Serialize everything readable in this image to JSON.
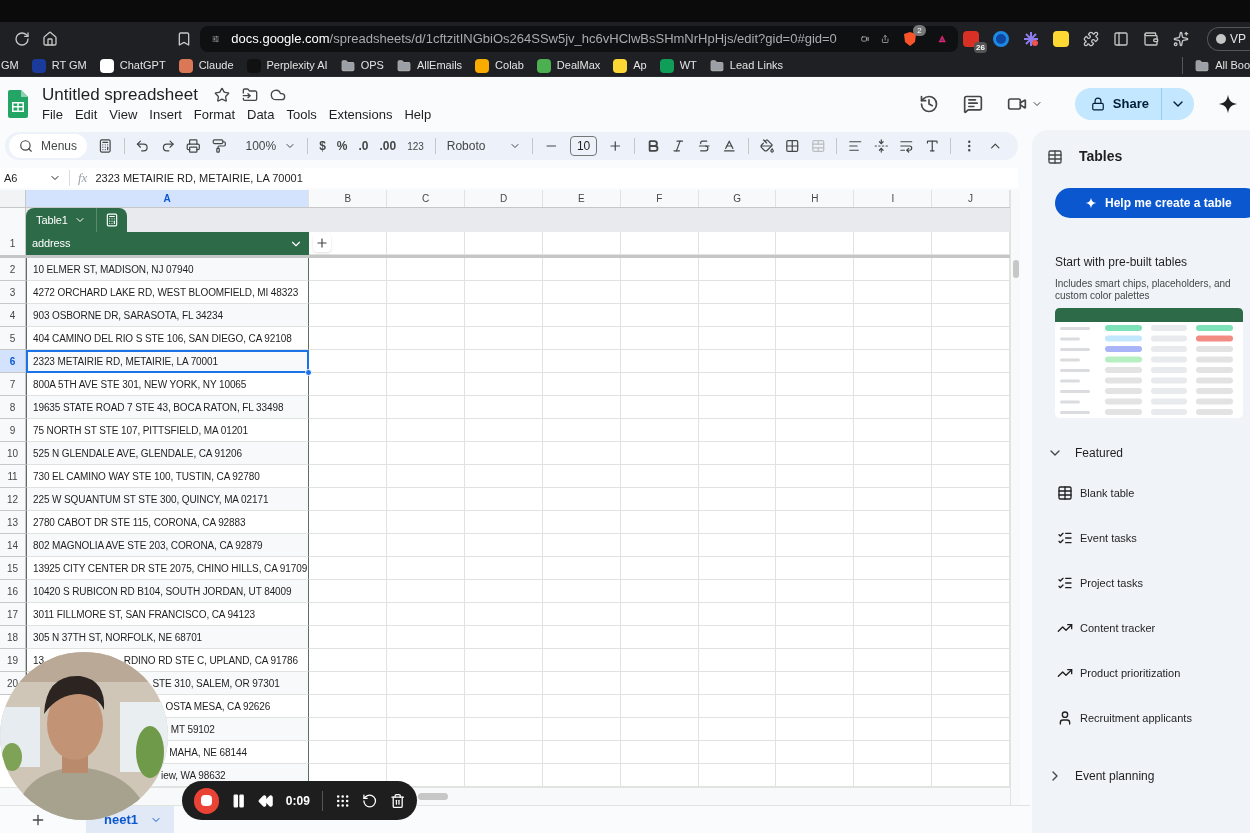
{
  "browser": {
    "url_host": "docs.google.com",
    "url_path": "/spreadsheets/d/1cftzitINGbiOs264SSw5jv_hc6vHClwBsSHmNrHpHjs/edit?gid=0#gid=0",
    "shield_badge": "2",
    "extensions": [
      {
        "kind": "calendar",
        "badge": "26"
      },
      {
        "kind": "ring"
      },
      {
        "kind": "burst"
      },
      {
        "kind": "tile"
      },
      {
        "kind": "puzzle"
      },
      {
        "kind": "sidebar"
      },
      {
        "kind": "wallet"
      },
      {
        "kind": "sparkle"
      }
    ],
    "profile": "VP"
  },
  "bookmarks": [
    {
      "label": "GM"
    },
    {
      "label": "RT GM",
      "kind": "site",
      "color": "#1a3a9c"
    },
    {
      "label": "ChatGPT",
      "kind": "site",
      "color": "#ffffff"
    },
    {
      "label": "Claude",
      "kind": "site",
      "color": "#d97757"
    },
    {
      "label": "Perplexity AI",
      "kind": "site",
      "color": "#111111"
    },
    {
      "label": "OPS",
      "kind": "folder"
    },
    {
      "label": "AllEmails",
      "kind": "folder"
    },
    {
      "label": "Colab",
      "kind": "site",
      "color": "#f9ab00"
    },
    {
      "label": "DealMax",
      "kind": "site",
      "color": "#4caf50"
    },
    {
      "label": "Ap",
      "kind": "site",
      "color": "#fdd835"
    },
    {
      "label": "WT",
      "kind": "site",
      "color": "#0f9d58"
    },
    {
      "label": "Lead Links",
      "kind": "folder"
    }
  ],
  "bookmarks_right": [
    {
      "label": "All Boo",
      "kind": "folder"
    }
  ],
  "document": {
    "title": "Untitled spreadsheet",
    "menus": [
      "File",
      "Edit",
      "View",
      "Insert",
      "Format",
      "Data",
      "Tools",
      "Extensions",
      "Help"
    ],
    "share_label": "Share"
  },
  "toolbar": {
    "search_label": "Menus",
    "zoom": "100%",
    "number_formats": [
      "$",
      "%",
      ".0",
      ".00",
      "123"
    ],
    "font": "Roboto",
    "font_size": "10"
  },
  "formula_bar": {
    "cell_ref": "A6",
    "function_label": "fx",
    "value": "2323 METAIRIE RD, METAIRIE, LA 70001"
  },
  "grid": {
    "columns": [
      {
        "label": "A",
        "selected": true
      },
      {
        "label": "B",
        "selected": false
      },
      {
        "label": "C",
        "selected": false
      },
      {
        "label": "D",
        "selected": false
      },
      {
        "label": "E",
        "selected": false
      },
      {
        "label": "F",
        "selected": false
      },
      {
        "label": "G",
        "selected": false
      },
      {
        "label": "H",
        "selected": false
      },
      {
        "label": "I",
        "selected": false
      },
      {
        "label": "J",
        "selected": false
      }
    ],
    "table_name": "Table1",
    "header_row_number": "1",
    "header": "address",
    "rows": [
      {
        "number": "2",
        "address": "10 ELMER ST, MADISON, NJ 07940",
        "selected": false
      },
      {
        "number": "3",
        "address": "4272 ORCHARD LAKE RD, WEST BLOOMFIELD, MI 48323",
        "selected": false
      },
      {
        "number": "4",
        "address": "903 OSBORNE DR, SARASOTA, FL 34234",
        "selected": false
      },
      {
        "number": "5",
        "address": "404 CAMINO DEL RIO S STE 106, SAN DIEGO, CA 92108",
        "selected": false
      },
      {
        "number": "6",
        "address": "2323 METAIRIE RD, METAIRIE, LA 70001",
        "selected": true
      },
      {
        "number": "7",
        "address": "800A 5TH AVE STE 301, NEW YORK, NY 10065",
        "selected": false
      },
      {
        "number": "8",
        "address": "19635 STATE ROAD 7 STE 43, BOCA RATON, FL 33498",
        "selected": false
      },
      {
        "number": "9",
        "address": "75 NORTH ST STE 107, PITTSFIELD, MA 01201",
        "selected": false
      },
      {
        "number": "10",
        "address": "525 N GLENDALE AVE, GLENDALE, CA 91206",
        "selected": false
      },
      {
        "number": "11",
        "address": "730 EL CAMINO WAY STE 100, TUSTIN, CA 92780",
        "selected": false
      },
      {
        "number": "12",
        "address": "225 W SQUANTUM ST STE 300, QUINCY, MA 02171",
        "selected": false
      },
      {
        "number": "13",
        "address": "2780 CABOT DR STE 115, CORONA, CA 92883",
        "selected": false
      },
      {
        "number": "14",
        "address": "802 MAGNOLIA AVE STE 203, CORONA, CA 92879",
        "selected": false
      },
      {
        "number": "15",
        "address": "13925 CITY CENTER DR STE 2075, CHINO HILLS, CA 91709",
        "selected": false
      },
      {
        "number": "16",
        "address": "10420 S RUBICON RD B104, SOUTH JORDAN, UT 84009",
        "selected": false
      },
      {
        "number": "17",
        "address": "3011 FILLMORE ST, SAN FRANCISCO, CA 94123",
        "selected": false
      },
      {
        "number": "18",
        "address": "305 N 37TH ST, NORFOLK, NE 68701",
        "selected": false
      },
      {
        "number": "19",
        "lead": "13",
        "address": "RDINO RD STE C, UPLAND, CA 91786",
        "selected": false
      },
      {
        "number": "20",
        "address": "STE 310, SALEM, OR 97301",
        "selected": false
      },
      {
        "address": "OSTA MESA, CA 92626",
        "selected": false
      },
      {
        "address": "MT 59102",
        "selected": false
      },
      {
        "address": "MAHA, NE 68144",
        "selected": false
      },
      {
        "address": "iew, WA 98632",
        "selected": false
      }
    ]
  },
  "sheet_tabs": [
    {
      "label": "heet1",
      "selected": true
    }
  ],
  "recorder": {
    "time": "0:09"
  },
  "sidebar": {
    "title": "Tables",
    "help_button": "Help me create a table",
    "heading": "Start with pre-built tables",
    "description": "Includes smart chips, placeholders, and custom color palettes",
    "sections": [
      {
        "title": "Featured",
        "expanded": true,
        "items": [
          {
            "label": "Blank table",
            "kind": "table"
          },
          {
            "label": "Event tasks",
            "kind": "checklist"
          },
          {
            "label": "Project tasks",
            "kind": "checklist"
          },
          {
            "label": "Content tracker",
            "kind": "trend"
          },
          {
            "label": "Product prioritization",
            "kind": "trend"
          },
          {
            "label": "Recruitment applicants",
            "kind": "person"
          }
        ]
      },
      {
        "title": "Event planning",
        "expanded": false
      }
    ]
  }
}
